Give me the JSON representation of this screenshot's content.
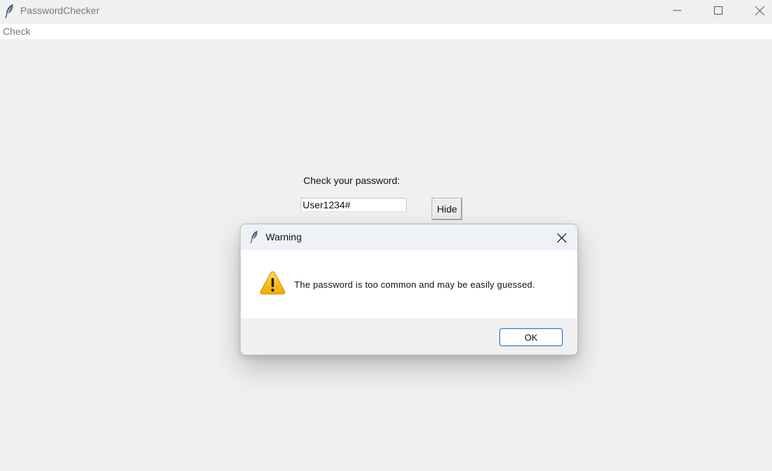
{
  "window": {
    "title": "PasswordChecker",
    "icon": "feather-icon",
    "controls": {
      "minimize": "minimize-icon",
      "maximize": "maximize-icon",
      "close": "close-icon"
    }
  },
  "menubar": {
    "items": [
      {
        "label": "Check"
      }
    ]
  },
  "main": {
    "prompt_label": "Check your password:",
    "password_value": "User1234#",
    "hide_button_label": "Hide"
  },
  "dialog": {
    "title": "Warning",
    "icon": "feather-icon",
    "message_icon": "warning-icon",
    "message": "The password is too common and may be easily guessed.",
    "ok_label": "OK",
    "colors": {
      "warning": "#f6b400",
      "ok_border": "#2e76c8"
    }
  }
}
